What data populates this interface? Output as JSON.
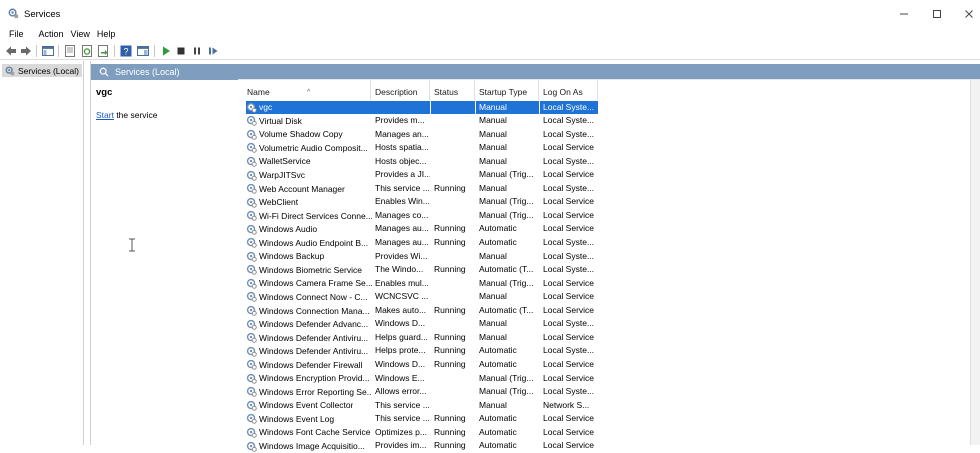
{
  "window": {
    "title": "Services"
  },
  "menu": [
    "File",
    "Action",
    "View",
    "Help"
  ],
  "tree": {
    "root_label": "Services (Local)"
  },
  "main_header": "Services (Local)",
  "extended": {
    "service_name": "vgc",
    "start_link": "Start",
    "start_suffix": " the service"
  },
  "columns": {
    "name": "Name",
    "description": "Description",
    "status": "Status",
    "startup_type": "Startup Type",
    "log_on_as": "Log On As"
  },
  "colors": {
    "header_bar": "#7f9dbe",
    "selection": "#1f72d6",
    "link": "#1a56c8"
  },
  "services": [
    {
      "name": "vgc",
      "description": "",
      "status": "",
      "startup": "Manual",
      "logon": "Local Syste...",
      "selected": true
    },
    {
      "name": "Virtual Disk",
      "description": "Provides m...",
      "status": "",
      "startup": "Manual",
      "logon": "Local Syste..."
    },
    {
      "name": "Volume Shadow Copy",
      "description": "Manages an...",
      "status": "",
      "startup": "Manual",
      "logon": "Local Syste..."
    },
    {
      "name": "Volumetric Audio Composit...",
      "description": "Hosts spatia...",
      "status": "",
      "startup": "Manual",
      "logon": "Local Service"
    },
    {
      "name": "WalletService",
      "description": "Hosts objec...",
      "status": "",
      "startup": "Manual",
      "logon": "Local Syste..."
    },
    {
      "name": "WarpJITSvc",
      "description": "Provides a JI...",
      "status": "",
      "startup": "Manual (Trig...",
      "logon": "Local Service"
    },
    {
      "name": "Web Account Manager",
      "description": "This service ...",
      "status": "Running",
      "startup": "Manual",
      "logon": "Local Syste..."
    },
    {
      "name": "WebClient",
      "description": "Enables Win...",
      "status": "",
      "startup": "Manual (Trig...",
      "logon": "Local Service"
    },
    {
      "name": "Wi-Fi Direct Services Conne...",
      "description": "Manages co...",
      "status": "",
      "startup": "Manual (Trig...",
      "logon": "Local Service"
    },
    {
      "name": "Windows Audio",
      "description": "Manages au...",
      "status": "Running",
      "startup": "Automatic",
      "logon": "Local Service"
    },
    {
      "name": "Windows Audio Endpoint B...",
      "description": "Manages au...",
      "status": "Running",
      "startup": "Automatic",
      "logon": "Local Syste..."
    },
    {
      "name": "Windows Backup",
      "description": "Provides Wi...",
      "status": "",
      "startup": "Manual",
      "logon": "Local Syste..."
    },
    {
      "name": "Windows Biometric Service",
      "description": "The Windo...",
      "status": "Running",
      "startup": "Automatic (T...",
      "logon": "Local Syste..."
    },
    {
      "name": "Windows Camera Frame Se...",
      "description": "Enables mul...",
      "status": "",
      "startup": "Manual (Trig...",
      "logon": "Local Service"
    },
    {
      "name": "Windows Connect Now - C...",
      "description": "WCNCSVC ...",
      "status": "",
      "startup": "Manual",
      "logon": "Local Service"
    },
    {
      "name": "Windows Connection Mana...",
      "description": "Makes auto...",
      "status": "Running",
      "startup": "Automatic (T...",
      "logon": "Local Service"
    },
    {
      "name": "Windows Defender Advanc...",
      "description": "Windows D...",
      "status": "",
      "startup": "Manual",
      "logon": "Local Syste..."
    },
    {
      "name": "Windows Defender Antiviru...",
      "description": "Helps guard...",
      "status": "Running",
      "startup": "Manual",
      "logon": "Local Service"
    },
    {
      "name": "Windows Defender Antiviru...",
      "description": "Helps prote...",
      "status": "Running",
      "startup": "Automatic",
      "logon": "Local Syste..."
    },
    {
      "name": "Windows Defender Firewall",
      "description": "Windows D...",
      "status": "Running",
      "startup": "Automatic",
      "logon": "Local Service"
    },
    {
      "name": "Windows Encryption Provid...",
      "description": "Windows E...",
      "status": "",
      "startup": "Manual (Trig...",
      "logon": "Local Service"
    },
    {
      "name": "Windows Error Reporting Se...",
      "description": "Allows error...",
      "status": "",
      "startup": "Manual (Trig...",
      "logon": "Local Syste..."
    },
    {
      "name": "Windows Event Collector",
      "description": "This service ...",
      "status": "",
      "startup": "Manual",
      "logon": "Network S..."
    },
    {
      "name": "Windows Event Log",
      "description": "This service ...",
      "status": "Running",
      "startup": "Automatic",
      "logon": "Local Service"
    },
    {
      "name": "Windows Font Cache Service",
      "description": "Optimizes p...",
      "status": "Running",
      "startup": "Automatic",
      "logon": "Local Service"
    },
    {
      "name": "Windows Image Acquisitio...",
      "description": "Provides im...",
      "status": "Running",
      "startup": "Automatic",
      "logon": "Local Service"
    }
  ]
}
